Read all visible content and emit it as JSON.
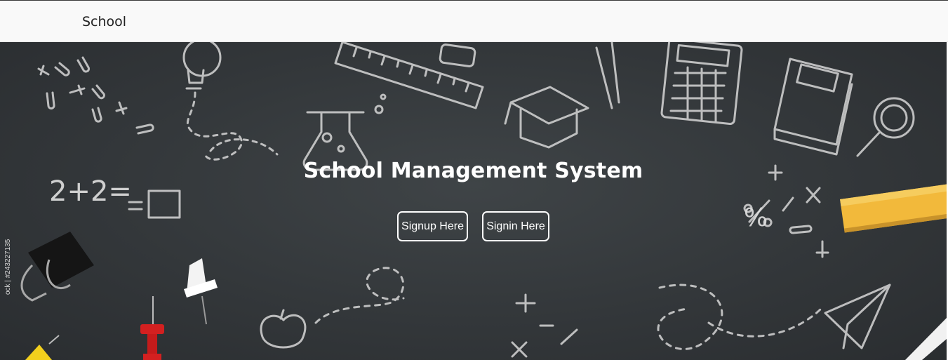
{
  "navbar": {
    "brand": "School"
  },
  "hero": {
    "title": "School Management System",
    "signup_label": "Signup Here",
    "signin_label": "Signin Here",
    "stock_id": "ock | #243227135",
    "chalk_math": "2+2=",
    "chalk_percent": "%"
  },
  "colors": {
    "navbar_bg": "#f9f9f9",
    "chalkboard": "#35393c",
    "chalk_lines": "#d9d9d9",
    "button_border": "#ffffff",
    "chalk_yellow": "#f2b93b",
    "pin_red": "#d32020"
  }
}
